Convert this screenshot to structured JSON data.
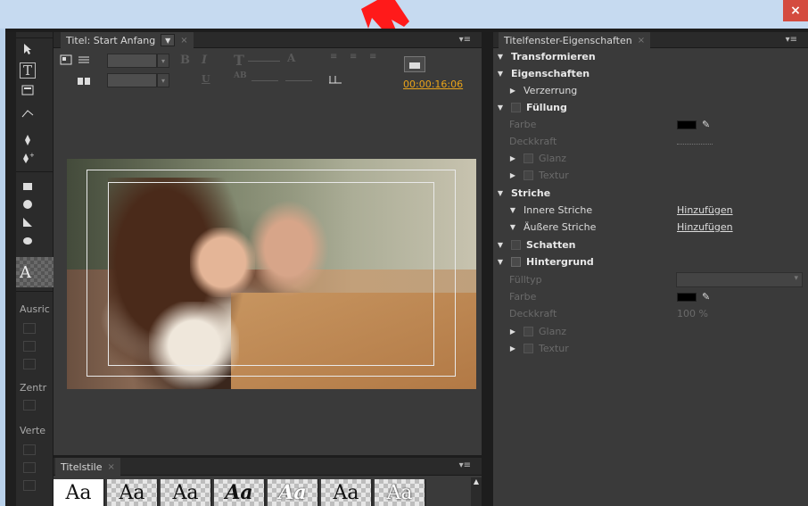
{
  "title_panel": {
    "tab_label": "Titel: Start Anfang",
    "timecode": "00:00:16:06"
  },
  "styles_panel": {
    "tab_label": "Titelstile",
    "swatches": [
      "Aa",
      "Aa",
      "Aa",
      "Aa",
      "Aa",
      "Aa",
      "Aa"
    ]
  },
  "tools_panel": {
    "labels": [
      "Ausric",
      "Zentr",
      "Verte"
    ]
  },
  "props_panel": {
    "tab_label": "Titelfenster-Eigenschaften",
    "rows": {
      "transformieren": "Transformieren",
      "eigenschaften": "Eigenschaften",
      "verzerrung": "Verzerrung",
      "fuellung": "Füllung",
      "farbe1": "Farbe",
      "deckkraft1": "Deckkraft",
      "glanz1": "Glanz",
      "textur1": "Textur",
      "striche": "Striche",
      "innere": "Innere Striche",
      "aeussere": "Äußere Striche",
      "hinzufuegen1": "Hinzufügen",
      "hinzufuegen2": "Hinzufügen",
      "schatten": "Schatten",
      "hintergrund": "Hintergrund",
      "fuelltyp": "Fülltyp",
      "farbe2": "Farbe",
      "deckkraft2": "Deckkraft",
      "deckkraft2_value": "100 %",
      "glanz2": "Glanz",
      "textur2": "Textur"
    }
  },
  "window": {
    "close_glyph": "×"
  }
}
